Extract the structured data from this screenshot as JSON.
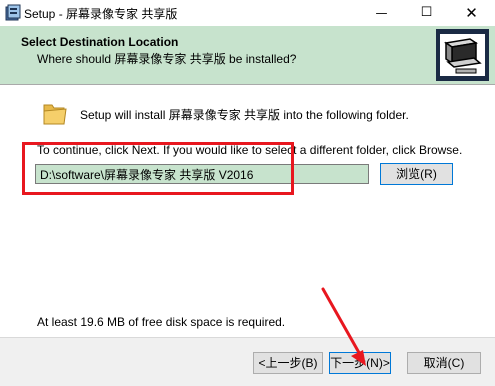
{
  "window": {
    "title": "Setup - 屏幕录像专家 共享版",
    "minimize_label": "—",
    "maximize_label": "☐",
    "close_label": "✕"
  },
  "header": {
    "title": "Select Destination Location",
    "subtitle": "Where should 屏幕录像专家 共享版 be installed?"
  },
  "body": {
    "install_text": "Setup will install 屏幕录像专家 共享版 into the following folder.",
    "continue_text": "To continue, click Next. If you would like to select a different folder, click Browse.",
    "path_value": "D:\\software\\屏幕录像专家 共享版 V2016",
    "browse_label": "浏览(R)",
    "space_text": "At least 19.6 MB of free disk space is required."
  },
  "footer": {
    "back_label": "<上一步(B)",
    "next_label": "下一步(N)>",
    "cancel_label": "取消(C)"
  },
  "colors": {
    "accent": "#c7e3cd",
    "annotation": "#e8171f",
    "focus_border": "#0078d7"
  },
  "icons": [
    "setup-app-icon",
    "folder-icon",
    "wizard-computer-icon"
  ]
}
